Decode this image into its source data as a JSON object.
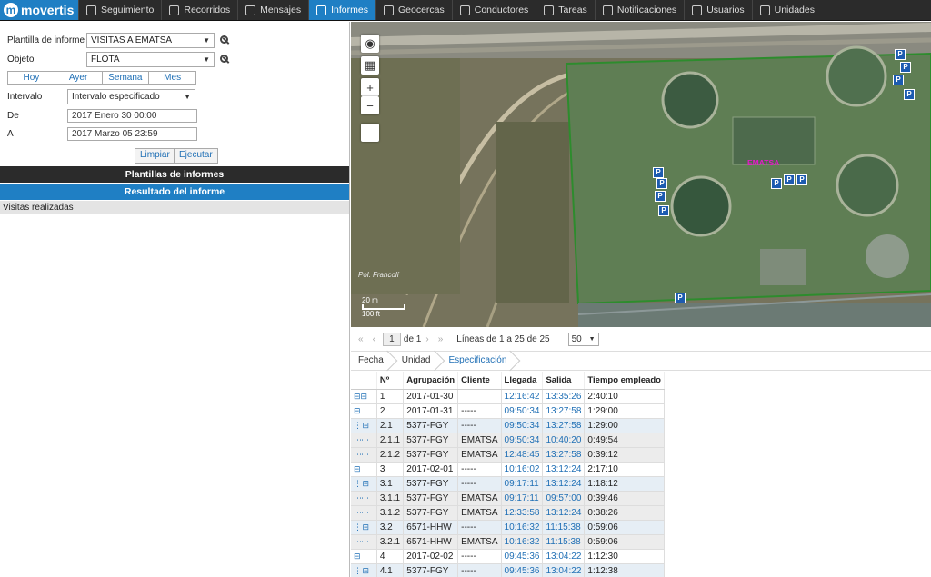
{
  "brand": "movertis",
  "nav": [
    {
      "label": "Seguimiento",
      "icon": "globe-icon",
      "active": false
    },
    {
      "label": "Recorridos",
      "icon": "route-flag-icon",
      "active": false
    },
    {
      "label": "Mensajes",
      "icon": "message-icon",
      "active": false
    },
    {
      "label": "Informes",
      "icon": "report-icon",
      "active": true
    },
    {
      "label": "Geocercas",
      "icon": "geofence-icon",
      "active": false
    },
    {
      "label": "Conductores",
      "icon": "steering-wheel-icon",
      "active": false
    },
    {
      "label": "Tareas",
      "icon": "tasks-icon",
      "active": false
    },
    {
      "label": "Notificaciones",
      "icon": "alarm-clock-icon",
      "active": false
    },
    {
      "label": "Usuarios",
      "icon": "user-icon",
      "active": false
    },
    {
      "label": "Unidades",
      "icon": "bus-icon",
      "active": false
    }
  ],
  "form": {
    "template_label": "Plantilla de informe",
    "template_value": "VISITAS A EMATSA",
    "object_label": "Objeto",
    "object_value": "FLOTA",
    "period_tabs": [
      "Hoy",
      "Ayer",
      "Semana",
      "Mes"
    ],
    "interval_label": "Intervalo",
    "interval_value": "Intervalo especificado",
    "from_label": "De",
    "from_value": "2017 Enero 30 00:00",
    "to_label": "A",
    "to_value": "2017 Marzo 05 23:59",
    "clear_label": "Limpiar",
    "run_label": "Ejecutar"
  },
  "sections": {
    "templates": "Plantillas de informes",
    "result": "Resultado del informe",
    "visits": "Visitas realizadas"
  },
  "map": {
    "street": "Pol. Francolí",
    "place": "EMATSA",
    "scale_m": "20 m",
    "scale_ft": "100 ft"
  },
  "pager": {
    "page": "1",
    "of": "de 1",
    "lines": "Líneas de 1 a 25 de 25",
    "size": "50"
  },
  "crumbs": [
    "Fecha",
    "Unidad",
    "Especificación"
  ],
  "table": {
    "headers": [
      "Nº",
      "Agrupación",
      "Cliente",
      "Llegada",
      "Salida",
      "Tiempo empleado"
    ],
    "rows": [
      {
        "ctl": "⊟⊟",
        "kind": "top",
        "n": "1",
        "group": "2017-01-30",
        "client": "",
        "in": "12:16:42",
        "out": "13:35:26",
        "time": "2:40:10"
      },
      {
        "ctl": "⊟",
        "kind": "top",
        "n": "2",
        "group": "2017-01-31",
        "client": "-----",
        "in": "09:50:34",
        "out": "13:27:58",
        "time": "1:29:00"
      },
      {
        "ctl": "⊟",
        "kind": "sub",
        "n": "2.1",
        "group": "5377-FGY",
        "client": "-----",
        "in": "09:50:34",
        "out": "13:27:58",
        "time": "1:29:00"
      },
      {
        "ctl": "",
        "kind": "leaf",
        "n": "2.1.1",
        "group": "5377-FGY",
        "client": "EMATSA",
        "in": "09:50:34",
        "out": "10:40:20",
        "time": "0:49:54"
      },
      {
        "ctl": "",
        "kind": "leaf",
        "n": "2.1.2",
        "group": "5377-FGY",
        "client": "EMATSA",
        "in": "12:48:45",
        "out": "13:27:58",
        "time": "0:39:12"
      },
      {
        "ctl": "⊟",
        "kind": "top",
        "n": "3",
        "group": "2017-02-01",
        "client": "-----",
        "in": "10:16:02",
        "out": "13:12:24",
        "time": "2:17:10"
      },
      {
        "ctl": "⊟",
        "kind": "sub",
        "n": "3.1",
        "group": "5377-FGY",
        "client": "-----",
        "in": "09:17:11",
        "out": "13:12:24",
        "time": "1:18:12"
      },
      {
        "ctl": "",
        "kind": "leaf",
        "n": "3.1.1",
        "group": "5377-FGY",
        "client": "EMATSA",
        "in": "09:17:11",
        "out": "09:57:00",
        "time": "0:39:46"
      },
      {
        "ctl": "",
        "kind": "leaf",
        "n": "3.1.2",
        "group": "5377-FGY",
        "client": "EMATSA",
        "in": "12:33:58",
        "out": "13:12:24",
        "time": "0:38:26"
      },
      {
        "ctl": "⊟",
        "kind": "sub",
        "n": "3.2",
        "group": "6571-HHW",
        "client": "-----",
        "in": "10:16:32",
        "out": "11:15:38",
        "time": "0:59:06"
      },
      {
        "ctl": "",
        "kind": "leaf",
        "n": "3.2.1",
        "group": "6571-HHW",
        "client": "EMATSA",
        "in": "10:16:32",
        "out": "11:15:38",
        "time": "0:59:06"
      },
      {
        "ctl": "⊟",
        "kind": "top",
        "n": "4",
        "group": "2017-02-02",
        "client": "-----",
        "in": "09:45:36",
        "out": "13:04:22",
        "time": "1:12:30"
      },
      {
        "ctl": "⊟",
        "kind": "sub",
        "n": "4.1",
        "group": "5377-FGY",
        "client": "-----",
        "in": "09:45:36",
        "out": "13:04:22",
        "time": "1:12:38"
      }
    ]
  }
}
